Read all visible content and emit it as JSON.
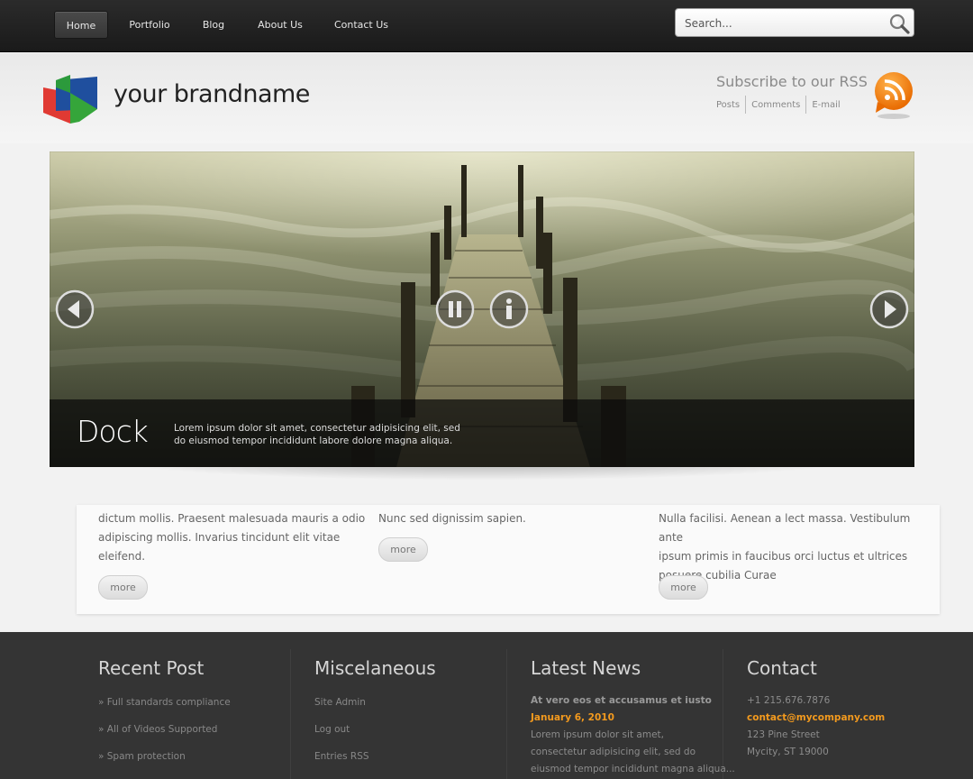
{
  "nav": {
    "items": [
      {
        "label": "Home",
        "active": true
      },
      {
        "label": "Portfolio",
        "active": false
      },
      {
        "label": "Blog",
        "active": false
      },
      {
        "label": "About Us",
        "active": false
      },
      {
        "label": "Contact Us",
        "active": false
      }
    ],
    "search_placeholder": "Search..."
  },
  "header": {
    "brand": "your brandname",
    "rss_title": "Subscribe to our RSS",
    "rss_links": [
      "Posts",
      "Comments",
      "E-mail"
    ]
  },
  "slider": {
    "caption_title": "Dock",
    "caption_text": "Lorem ipsum dolor sit amet, consectetur adipisicing elit, sed do eiusmod tempor incididunt labore dolore magna aliqua."
  },
  "content": {
    "columns": [
      {
        "lines": [
          "dictum mollis. Praesent malesuada mauris a odio",
          "adipiscing mollis. Invarius tincidunt elit vitae",
          "eleifend."
        ],
        "more": "more"
      },
      {
        "lines": [
          "Nunc sed dignissim sapien."
        ],
        "more": "more"
      },
      {
        "lines": [
          "Nulla facilisi. Aenean a lect massa. Vestibulum ante",
          "ipsum primis in faucibus orci luctus et ultrices",
          "posuere cubilia Curae"
        ],
        "more": "more"
      }
    ]
  },
  "footer": {
    "recent_post": {
      "title": "Recent Post",
      "links": [
        "» Full standards compliance",
        "» All of Videos Supported",
        "» Spam protection"
      ]
    },
    "misc": {
      "title": "Miscelaneous",
      "links": [
        "Site Admin",
        "Log out",
        "Entries RSS"
      ]
    },
    "news": {
      "title": "Latest News",
      "headline": "At vero eos et accusamus et iusto",
      "date": "January 6, 2010",
      "body": [
        "Lorem ipsum dolor sit amet,",
        "consectetur adipisicing elit, sed do",
        "eiusmod tempor incididunt magna aliqua..."
      ]
    },
    "contact": {
      "title": "Contact",
      "phone": "+1 215.676.7876",
      "email": "contact@mycompany.com",
      "street": "123 Pine Street",
      "city": "Mycity, ST 19000"
    }
  },
  "colors": {
    "accent": "#f39a1e",
    "nav_bg": "#1f1f1f",
    "footer_bg": "#343434"
  }
}
